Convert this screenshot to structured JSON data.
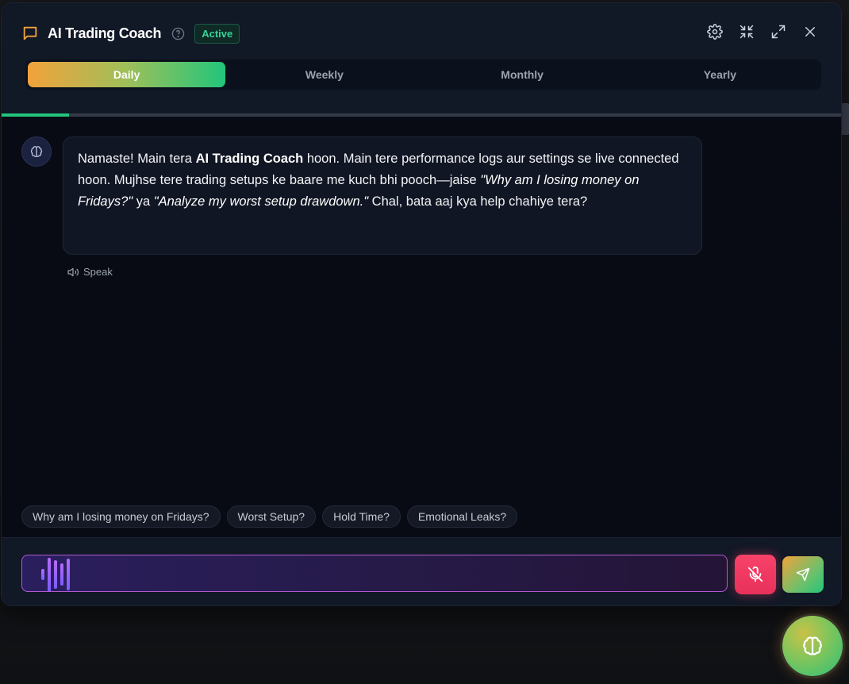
{
  "header": {
    "title": "AI Trading Coach",
    "status": "Active",
    "icons": {
      "chat": "chat-bubble-icon",
      "help": "help-circle-icon",
      "settings": "gear-icon",
      "collapse": "minimize-icon",
      "expand": "maximize-icon",
      "close": "close-icon"
    }
  },
  "tabs": [
    {
      "label": "Daily",
      "active": true
    },
    {
      "label": "Weekly",
      "active": false
    },
    {
      "label": "Monthly",
      "active": false
    },
    {
      "label": "Yearly",
      "active": false
    }
  ],
  "progress": {
    "fraction": 0.08
  },
  "message": {
    "p1": "Namaste! Main tera ",
    "b1": "AI Trading Coach",
    "p2": " hoon. Main tere performance logs aur settings se live connected hoon. Mujhse tere trading setups ke baare me kuch bhi pooch—jaise ",
    "i1": "\"Why am I losing money on Fridays?\"",
    "p3": " ya ",
    "i2": "\"Analyze my worst setup drawdown.\"",
    "p4": " Chal, bata aaj kya help chahiye tera?",
    "speak_label": "Speak"
  },
  "chips": [
    "Why am I losing money on Fridays?",
    "Worst Setup?",
    "Hold Time?",
    "Emotional Leaks?"
  ],
  "colors": {
    "accent_orange": "#f2a23b",
    "accent_green": "#22c57a",
    "mic_red": "#f8426a",
    "input_border": "#b15ad0"
  }
}
